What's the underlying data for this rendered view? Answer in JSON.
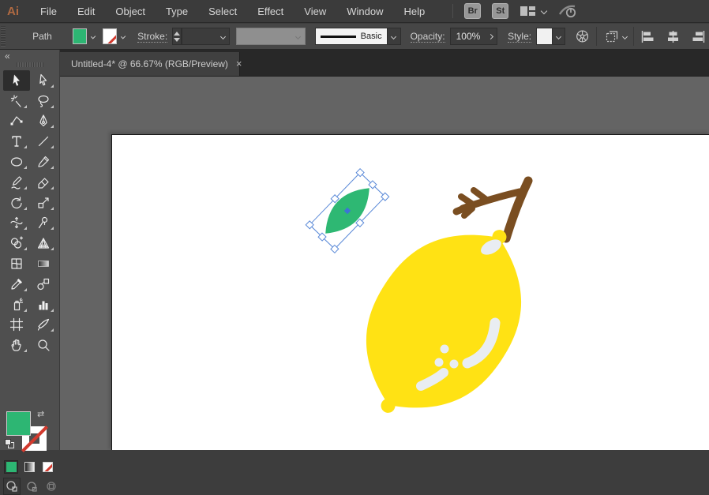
{
  "app": {
    "logo_text": "Ai"
  },
  "menubar": {
    "items": [
      "File",
      "Edit",
      "Object",
      "Type",
      "Select",
      "Effect",
      "View",
      "Window",
      "Help"
    ],
    "bridge_label": "Br",
    "stock_label": "St"
  },
  "control_bar": {
    "context_label": "Path",
    "stroke_label": "Stroke:",
    "brush_name": "Basic",
    "opacity_label": "Opacity:",
    "opacity_value": "100%",
    "style_label": "Style:"
  },
  "document_tab": {
    "title": "Untitled-4* @ 66.67% (RGB/Preview)",
    "close_glyph": "×"
  },
  "icons": {
    "collapse_panel": "«",
    "swap_fill_stroke": "⇄",
    "workspace_switcher": "layout-grid",
    "share": "power-swoosh",
    "recolor_artwork": "color-wheel",
    "isolate_mode": "dashed-box",
    "align_set": [
      "horizontal-align-left",
      "horizontal-align-center",
      "horizontal-align-right"
    ]
  },
  "toolbar": {
    "tools": [
      {
        "name": "selection",
        "label": "Selection Tool",
        "active": true,
        "sub": false
      },
      {
        "name": "direct-selection",
        "label": "Direct Selection Tool",
        "active": false,
        "sub": true
      },
      {
        "name": "magic-wand",
        "label": "Magic Wand Tool",
        "active": false,
        "sub": true
      },
      {
        "name": "lasso",
        "label": "Lasso Tool",
        "active": false,
        "sub": true
      },
      {
        "name": "curvature",
        "label": "Curvature Tool",
        "active": false,
        "sub": false
      },
      {
        "name": "pen",
        "label": "Pen Tool",
        "active": false,
        "sub": true
      },
      {
        "name": "type",
        "label": "Type Tool",
        "active": false,
        "sub": true
      },
      {
        "name": "line-segment",
        "label": "Line Segment Tool",
        "active": false,
        "sub": true
      },
      {
        "name": "ellipse",
        "label": "Ellipse Tool",
        "active": false,
        "sub": true
      },
      {
        "name": "paintbrush",
        "label": "Paintbrush Tool",
        "active": false,
        "sub": true
      },
      {
        "name": "shaper",
        "label": "Shaper Tool",
        "active": false,
        "sub": true
      },
      {
        "name": "eraser",
        "label": "Eraser Tool",
        "active": false,
        "sub": true
      },
      {
        "name": "rotate",
        "label": "Rotate Tool",
        "active": false,
        "sub": true
      },
      {
        "name": "scale",
        "label": "Scale Tool",
        "active": false,
        "sub": true
      },
      {
        "name": "width",
        "label": "Width Tool",
        "active": false,
        "sub": true
      },
      {
        "name": "puppet-warp",
        "label": "Puppet Warp Tool",
        "active": false,
        "sub": true
      },
      {
        "name": "shape-builder",
        "label": "Shape Builder Tool",
        "active": false,
        "sub": true
      },
      {
        "name": "perspective-grid",
        "label": "Perspective Grid Tool",
        "active": false,
        "sub": true
      },
      {
        "name": "mesh",
        "label": "Mesh Tool",
        "active": false,
        "sub": false
      },
      {
        "name": "gradient",
        "label": "Gradient Tool",
        "active": false,
        "sub": false
      },
      {
        "name": "eyedropper",
        "label": "Eyedropper Tool",
        "active": false,
        "sub": true
      },
      {
        "name": "blend",
        "label": "Blend Tool",
        "active": false,
        "sub": false
      },
      {
        "name": "symbol-sprayer",
        "label": "Symbol Sprayer Tool",
        "active": false,
        "sub": true
      },
      {
        "name": "column-graph",
        "label": "Column Graph Tool",
        "active": false,
        "sub": true
      },
      {
        "name": "artboard",
        "label": "Artboard Tool",
        "active": false,
        "sub": false
      },
      {
        "name": "slice",
        "label": "Slice Tool",
        "active": false,
        "sub": true
      },
      {
        "name": "hand",
        "label": "Hand Tool",
        "active": false,
        "sub": true
      },
      {
        "name": "zoom",
        "label": "Zoom Tool",
        "active": false,
        "sub": false
      }
    ],
    "paint_buttons": [
      "Color",
      "Gradient",
      "None"
    ],
    "draw_modes": [
      "Draw Normal",
      "Draw Behind",
      "Draw Inside"
    ]
  },
  "swatches": {
    "fill_color": "#2DB673",
    "stroke_style": "none",
    "none_red": "#D23A2E"
  },
  "artwork": {
    "leaf_fill": "#2EB873",
    "lemon_fill": "#FFE214",
    "stem_color": "#7A4E21",
    "highlight_fill": "#E9EDF2",
    "selection_stroke": "#5B8AD8",
    "selection_handle_fill": "#FFFFFF",
    "selection_center_fill": "#3D73D6"
  },
  "canvas": {
    "pasteboard_bg": "#646464",
    "artboard_bg": "#FFFFFF"
  }
}
